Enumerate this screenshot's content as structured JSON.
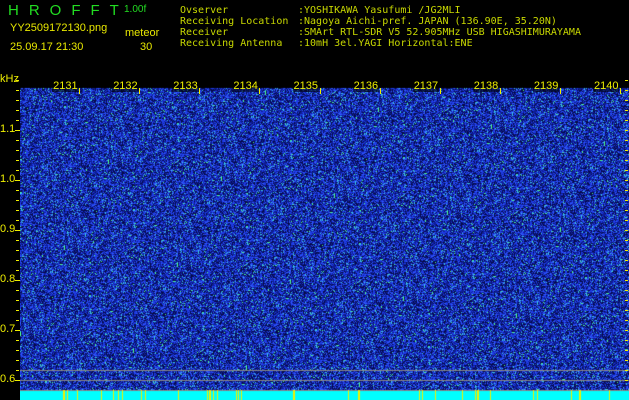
{
  "header": {
    "app_title": "HROFFT",
    "version": "1.00f",
    "filename": "YY2509172130.png",
    "datetime": "25.09.17 21:30",
    "mode_label": "meteor",
    "count": "30"
  },
  "info": [
    {
      "label": "Ovserver",
      "value": ":YOSHIKAWA Yasufumi /JG2MLI"
    },
    {
      "label": "Receiving Location",
      "value": ":Nagoya Aichi-pref. JAPAN (136.90E, 35.20N)"
    },
    {
      "label": "Receiver",
      "value": ":SMArt RTL-SDR V5 52.905MHz USB HIGASHIMURAYAMA"
    },
    {
      "label": "Receiving Antenna",
      "value": ":10mH 3el.YAGI Horizontal:ENE"
    }
  ],
  "chart_data": {
    "type": "heatmap",
    "title": "HROFFT spectrogram",
    "ylabel": "kHz",
    "xlabel": "",
    "x_ticks": [
      "2131",
      "2132",
      "2133",
      "2134",
      "2135",
      "2136",
      "2137",
      "2138",
      "2139",
      "2140"
    ],
    "y_ticks": [
      "1.1",
      "1.0",
      "0.9",
      "0.8",
      "0.7",
      "0.6"
    ],
    "ylim": [
      0.58,
      1.2
    ],
    "colors": {
      "background": "#000000",
      "low": "#0a1a90",
      "mid": "#2040ff",
      "high": "#30e0e0",
      "peak": "#40ff80",
      "bottom_band": "#00ffff",
      "axis": "#f0f000"
    }
  }
}
